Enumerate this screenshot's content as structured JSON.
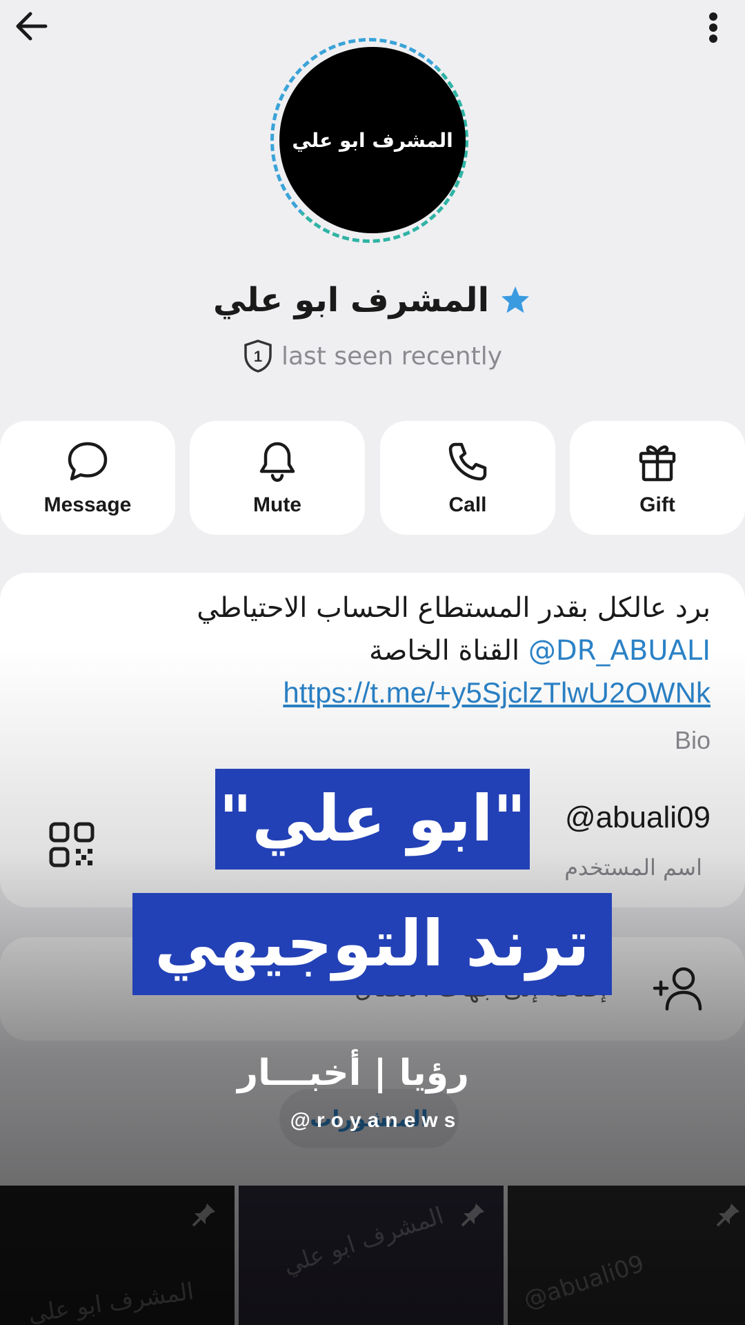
{
  "profile": {
    "avatar_text": "المشرف ابو علي",
    "name": "المشرف ابو علي",
    "status": "last seen recently"
  },
  "actions": [
    {
      "label": "Message",
      "icon": "chat-bubble-icon"
    },
    {
      "label": "Mute",
      "icon": "bell-icon"
    },
    {
      "label": "Call",
      "icon": "phone-icon"
    },
    {
      "label": "Gift",
      "icon": "gift-icon"
    }
  ],
  "info": {
    "bio_line1": "برد عالكل بقدر المستطاع الحساب الاحتياطي",
    "bio_mention": "DR_ABUALI@",
    "bio_line2_rest": "القناة الخاصة",
    "bio_link": "https://t.me/+y5SjclzTlwU2OWNk",
    "bio_label": "Bio",
    "username": "@abuali09",
    "username_label": "اسم المستخدم"
  },
  "add_contact": {
    "label": "إضافة إلى جهات الاتصال",
    "icon": "add-person-icon"
  },
  "posts_tab": "المنشورات",
  "thumbnails": [
    {
      "text": "المشرف ابو علي"
    },
    {
      "text": "المشرف ابو علي"
    },
    {
      "text": "@abuali09"
    }
  ],
  "overlay": {
    "headline1": "\"ابو علي\"",
    "headline2": "ترند التوجيهي",
    "logo_text": "رؤيا | أخبـــار",
    "logo_handle": "@royanews"
  },
  "colors": {
    "accent": "#2b82c7",
    "headline_bg": "#2341b6",
    "background": "#efeff2"
  }
}
